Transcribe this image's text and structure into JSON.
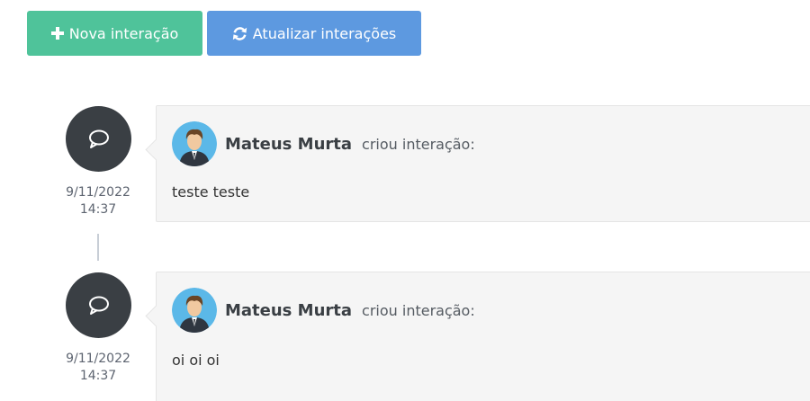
{
  "toolbar": {
    "new_label": "Nova interação",
    "refresh_label": "Atualizar interações",
    "new_icon": "plus-icon",
    "refresh_icon": "refresh-icon"
  },
  "timeline": {
    "entries": [
      {
        "icon": "speech-bubble-icon",
        "date": "9/11/2022",
        "time": "14:37",
        "author": "Mateus Murta",
        "action": "criou interação:",
        "message": "teste teste"
      },
      {
        "icon": "speech-bubble-icon",
        "date": "9/11/2022",
        "time": "14:37",
        "author": "Mateus Murta",
        "action": "criou interação:",
        "message": "oi oi oi"
      }
    ]
  },
  "colors": {
    "new_button": "#4fc39a",
    "refresh_button": "#5d99e0",
    "timeline_circle": "#3a3f44",
    "card_background": "#f5f5f5"
  }
}
